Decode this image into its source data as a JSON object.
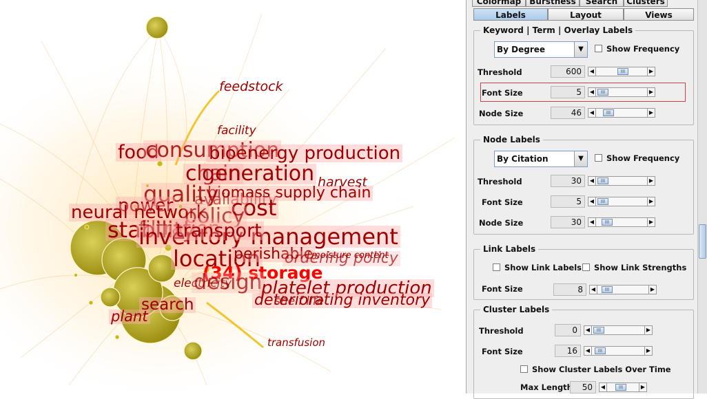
{
  "visualization": {
    "keywords": [
      {
        "text": "feedstock",
        "style": "small"
      },
      {
        "text": "facility",
        "style": "small"
      },
      {
        "text": "food",
        "style": "big"
      },
      {
        "text": "consumption",
        "style": "big"
      },
      {
        "text": "bioenergy production",
        "style": "big"
      },
      {
        "text": "chain",
        "style": "big"
      },
      {
        "text": "generation",
        "style": "big"
      },
      {
        "text": "harvest",
        "style": "mid"
      },
      {
        "text": "biomass supply chain",
        "style": "mid"
      },
      {
        "text": "quality",
        "style": "big"
      },
      {
        "text": "availability",
        "style": "mid"
      },
      {
        "text": "cost",
        "style": "big"
      },
      {
        "text": "power",
        "style": "big"
      },
      {
        "text": "neural network",
        "style": "big"
      },
      {
        "text": "policy",
        "style": "big"
      },
      {
        "text": "stability",
        "style": "big"
      },
      {
        "text": "filtration",
        "style": "big"
      },
      {
        "text": "inventory management",
        "style": "big"
      },
      {
        "text": "transport",
        "style": "big"
      },
      {
        "text": "location",
        "style": "big"
      },
      {
        "text": "perishable",
        "style": "mid"
      },
      {
        "text": "ordering policy",
        "style": "mid"
      },
      {
        "text": "moisture content",
        "style": "small"
      },
      {
        "text": "(34) storage",
        "style": "focus"
      },
      {
        "text": "electricity",
        "style": "mid"
      },
      {
        "text": "design",
        "style": "big"
      },
      {
        "text": "platelet production",
        "style": "big"
      },
      {
        "text": "deteriorating inventory",
        "style": "mid"
      },
      {
        "text": "shelf life",
        "style": "mid"
      },
      {
        "text": "search",
        "style": "big"
      },
      {
        "text": "plant",
        "style": "mid"
      },
      {
        "text": "transfusion",
        "style": "small"
      }
    ]
  },
  "panel": {
    "tabs_top": [
      "Colormap",
      "Burstness",
      "Search",
      "Clusters"
    ],
    "tabs": [
      "Labels",
      "Layout",
      "Views"
    ],
    "keyword_group": {
      "title": "Keyword | Term | Overlay Labels",
      "sort": "By Degree",
      "show_frequency": "Show Frequency",
      "threshold_label": "Threshold",
      "threshold": "600",
      "font_size_label": "Font Size",
      "font_size": "5",
      "node_size_label": "Node Size",
      "node_size": "46"
    },
    "node_group": {
      "title": "Node Labels",
      "sort": "By Citation",
      "show_frequency": "Show Frequency",
      "threshold_label": "Threshold",
      "threshold": "30",
      "font_size_label": "Font Size",
      "font_size": "5",
      "node_size_label": "Node Size",
      "node_size": "30"
    },
    "link_group": {
      "title": "Link Labels",
      "show_link_labels": "Show Link Labels",
      "show_link_strengths": "Show Link Strengths",
      "font_size_label": "Font Size",
      "font_size": "8"
    },
    "cluster_group": {
      "title": "Cluster Labels",
      "threshold_label": "Threshold",
      "threshold": "0",
      "font_size_label": "Font Size",
      "font_size": "16",
      "over_time": "Show Cluster Labels Over Time",
      "max_length_label": "Max Length",
      "max_length": "50"
    }
  },
  "colors": {
    "label_dark": "#a00000",
    "focus": "#ff0000",
    "node": "#b8ab20",
    "highlight_border": "#d04040"
  }
}
